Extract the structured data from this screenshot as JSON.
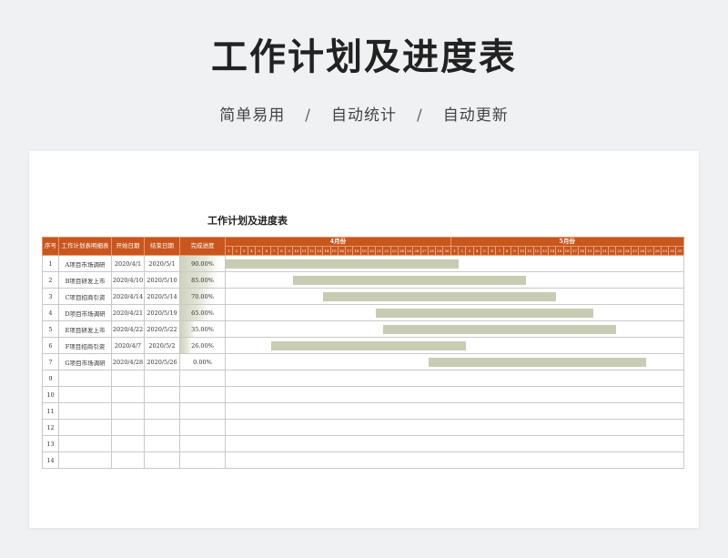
{
  "header": {
    "title": "工作计划及进度表",
    "features": [
      "简单易用",
      "自动统计",
      "自动更新"
    ],
    "separator": "/"
  },
  "sheet": {
    "title": "工作计划及进度表",
    "columns": [
      "序号",
      "工作计划表明细表",
      "开始日期",
      "结束日期",
      "完成进度"
    ],
    "months": [
      {
        "label": "4月份",
        "days": [
          1,
          2,
          3,
          4,
          5,
          6,
          7,
          8,
          9,
          10,
          11,
          12,
          13,
          14,
          15,
          16,
          17,
          18,
          19,
          20,
          21,
          22,
          23,
          24,
          25,
          26,
          27,
          28,
          29,
          30
        ]
      },
      {
        "label": "5月份",
        "days": [
          1,
          2,
          3,
          4,
          5,
          6,
          7,
          8,
          9,
          10,
          11,
          12,
          13,
          14,
          15,
          16,
          17,
          18,
          19,
          20,
          21,
          22,
          23,
          24,
          25,
          26,
          27,
          28,
          29,
          30,
          31
        ]
      }
    ],
    "colors": {
      "header": "#c8561d",
      "bar": "#c8ccb2"
    },
    "rows": [
      {
        "no": "1",
        "task": "A项目市场调研",
        "start": "2020/4/1",
        "end": "2020/5/1",
        "progress": "90.00%",
        "pct": 0.9,
        "s": 1,
        "e": 31
      },
      {
        "no": "2",
        "task": "B项目研发上市",
        "start": "2020/4/10",
        "end": "2020/5/10",
        "progress": "85.00%",
        "pct": 0.85,
        "s": 10,
        "e": 40
      },
      {
        "no": "3",
        "task": "C项目招商引资",
        "start": "2020/4/14",
        "end": "2020/5/14",
        "progress": "70.00%",
        "pct": 0.7,
        "s": 14,
        "e": 44
      },
      {
        "no": "4",
        "task": "D项目市场调研",
        "start": "2020/4/21",
        "end": "2020/5/19",
        "progress": "65.00%",
        "pct": 0.65,
        "s": 21,
        "e": 49
      },
      {
        "no": "5",
        "task": "E项目研发上市",
        "start": "2020/4/22",
        "end": "2020/5/22",
        "progress": "35.00%",
        "pct": 0.35,
        "s": 22,
        "e": 52
      },
      {
        "no": "6",
        "task": "F项目招商引资",
        "start": "2020/4/7",
        "end": "2020/5/2",
        "progress": "26.00%",
        "pct": 0.26,
        "s": 7,
        "e": 32
      },
      {
        "no": "7",
        "task": "G项目市场调研",
        "start": "2020/4/28",
        "end": "2020/5/26",
        "progress": "0.00%",
        "pct": 0,
        "s": 28,
        "e": 56
      },
      {
        "no": "9"
      },
      {
        "no": "10"
      },
      {
        "no": "11"
      },
      {
        "no": "12"
      },
      {
        "no": "13"
      },
      {
        "no": "14"
      }
    ]
  }
}
